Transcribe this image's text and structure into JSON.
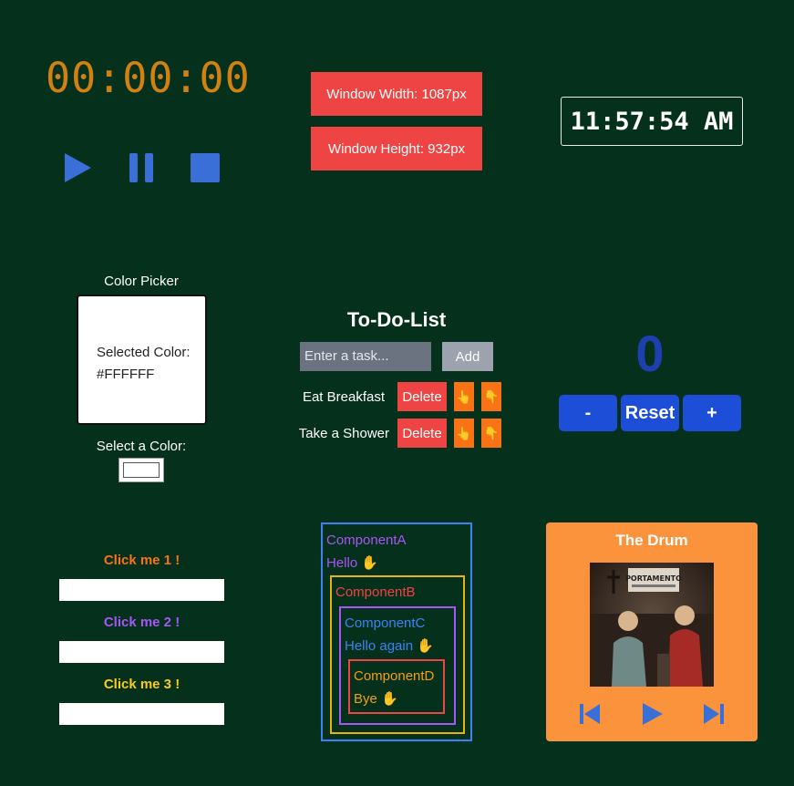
{
  "stopwatch": {
    "time": "00:00:00",
    "play_icon": "play-icon",
    "pause_icon": "pause-icon",
    "stop_icon": "stop-icon",
    "accent": "#3b6fd8"
  },
  "window_size": {
    "width_label": "Window Width: 1087px",
    "height_label": "Window Height: 932px"
  },
  "clock": {
    "time": "11:57:54 AM"
  },
  "color_picker": {
    "title": "Color Picker",
    "selected_label": "Selected Color:",
    "selected_value": "#FFFFFF",
    "select_label": "Select a Color:",
    "current_color": "#FFFFFF"
  },
  "todo": {
    "title": "To-Do-List",
    "input_placeholder": "Enter a task...",
    "add_label": "Add",
    "items": [
      {
        "text": "Eat Breakfast",
        "delete_label": "Delete",
        "up_label": "👆",
        "down_label": "👇"
      },
      {
        "text": "Take a Shower",
        "delete_label": "Delete",
        "up_label": "👆",
        "down_label": "👇"
      }
    ]
  },
  "counter": {
    "value": "0",
    "decrement_label": "-",
    "reset_label": "Reset",
    "increment_label": "+"
  },
  "click_me": [
    {
      "label": "Click me 1 !",
      "color": "#f97316"
    },
    {
      "label": "Click me 2 !",
      "color": "#a855f7"
    },
    {
      "label": "Click me 3 !",
      "color": "#facc15"
    }
  ],
  "components": {
    "a": {
      "name": "ComponentA",
      "message": "Hello ✋",
      "color": "#3b82f6",
      "text_color": "#a855f7"
    },
    "b": {
      "name": "ComponentB",
      "color": "#eab308",
      "text_color": "#ef4444"
    },
    "c": {
      "name": "ComponentC",
      "message": "Hello again ✋",
      "color": "#a855f7",
      "text_color": "#3b82f6"
    },
    "d": {
      "name": "ComponentD",
      "message": "Bye ✋",
      "color": "#ef4444",
      "text_color": "#f59e0b"
    }
  },
  "player": {
    "title": "The Drum",
    "album_sign": "PORTAMENTO",
    "prev_icon": "skip-back-icon",
    "play_icon": "play-icon",
    "next_icon": "skip-forward-icon"
  }
}
